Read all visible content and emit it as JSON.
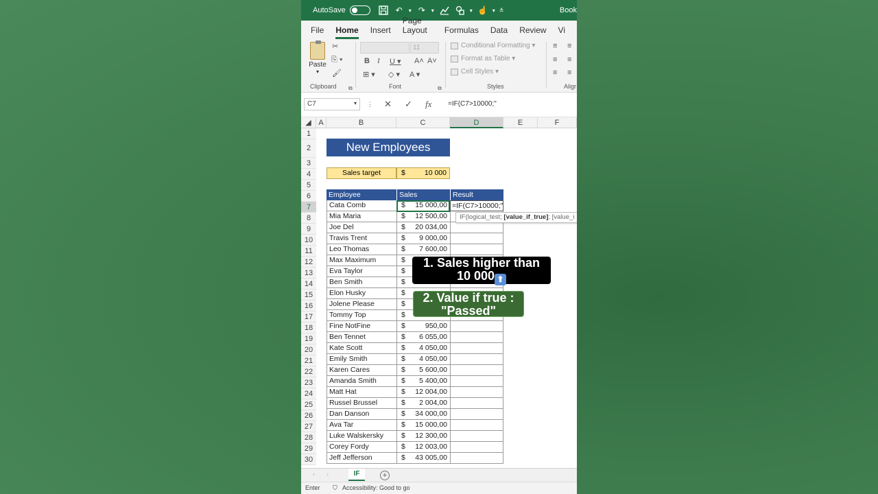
{
  "titlebar": {
    "autosave": "AutoSave",
    "book": "Book"
  },
  "tabs": [
    "File",
    "Home",
    "Insert",
    "Page Layout",
    "Formulas",
    "Data",
    "Review",
    "Vi"
  ],
  "ribbon": {
    "paste": "Paste",
    "font_size": "11",
    "conditional_formatting": "Conditional Formatting",
    "format_as_table": "Format as Table",
    "cell_styles": "Cell Styles",
    "groups": {
      "clipboard": "Clipboard",
      "font": "Font",
      "styles": "Styles",
      "alignment": "Aligr"
    }
  },
  "formula_bar": {
    "name_box": "C7",
    "fx": "fx",
    "formula": "=IF(C7>10000;\""
  },
  "columns": [
    "A",
    "B",
    "C",
    "D",
    "E",
    "F"
  ],
  "rows": [
    "1",
    "2",
    "3",
    "4",
    "5",
    "6",
    "7",
    "8",
    "9",
    "10",
    "11",
    "12",
    "13",
    "14",
    "15",
    "16",
    "17",
    "18",
    "19",
    "20",
    "21",
    "22",
    "23",
    "24",
    "25",
    "26",
    "27",
    "28",
    "29",
    "30"
  ],
  "sheet": {
    "title": "New Employees",
    "target_label": "Sales target",
    "target_currency": "$",
    "target_value": "10 000",
    "headers": {
      "employee": "Employee",
      "sales": "Sales",
      "result": "Result"
    },
    "currency": "$",
    "employees": [
      {
        "name": "Cata Comb",
        "sales": "15 000,00"
      },
      {
        "name": "Mia Maria",
        "sales": "12 500,00"
      },
      {
        "name": "Joe Del",
        "sales": "20 034,00"
      },
      {
        "name": "Travis Trent",
        "sales": "9 000,00"
      },
      {
        "name": "Leo Thomas",
        "sales": "7 600,00"
      },
      {
        "name": "Max Maximum",
        "sales": ""
      },
      {
        "name": "Eva Taylor",
        "sales": ""
      },
      {
        "name": "Ben Smith",
        "sales": ""
      },
      {
        "name": "Elon Husky",
        "sales": ""
      },
      {
        "name": "Jolene Please",
        "sales": ""
      },
      {
        "name": "Tommy Top",
        "sales": ""
      },
      {
        "name": "Fine NotFine",
        "sales": "950,00"
      },
      {
        "name": "Ben Tennet",
        "sales": "6 055,00"
      },
      {
        "name": "Kate Scott",
        "sales": "4 050,00"
      },
      {
        "name": "Emily Smith",
        "sales": "4 050,00"
      },
      {
        "name": "Karen Cares",
        "sales": "5 600,00"
      },
      {
        "name": "Amanda Smith",
        "sales": "5 400,00"
      },
      {
        "name": "Matt Hat",
        "sales": "12 004,00"
      },
      {
        "name": "Russel Brussel",
        "sales": "2 004,00"
      },
      {
        "name": "Dan Danson",
        "sales": "34 000,00"
      },
      {
        "name": "Ava Tar",
        "sales": "15 000,00"
      },
      {
        "name": "Luke Walskersky",
        "sales": "12 300,00"
      },
      {
        "name": "Corey Fordy",
        "sales": "12 003,00"
      },
      {
        "name": "Jeff Jefferson",
        "sales": "43 005,00"
      }
    ],
    "editing_formula": "=IF(C7>10000;\"",
    "tooltip": {
      "fn": "IF(logical_test; ",
      "bold": "[value_if_true]",
      "rest": "; [value_i"
    }
  },
  "callouts": {
    "one_line1": "1. Sales higher than",
    "one_line2": "10 000",
    "two_line1": "2. Value if true :",
    "two_line2": "\"Passed\""
  },
  "sheet_tab": "IF",
  "status": {
    "mode": "Enter",
    "accessibility": "Accessibility: Good to go"
  }
}
